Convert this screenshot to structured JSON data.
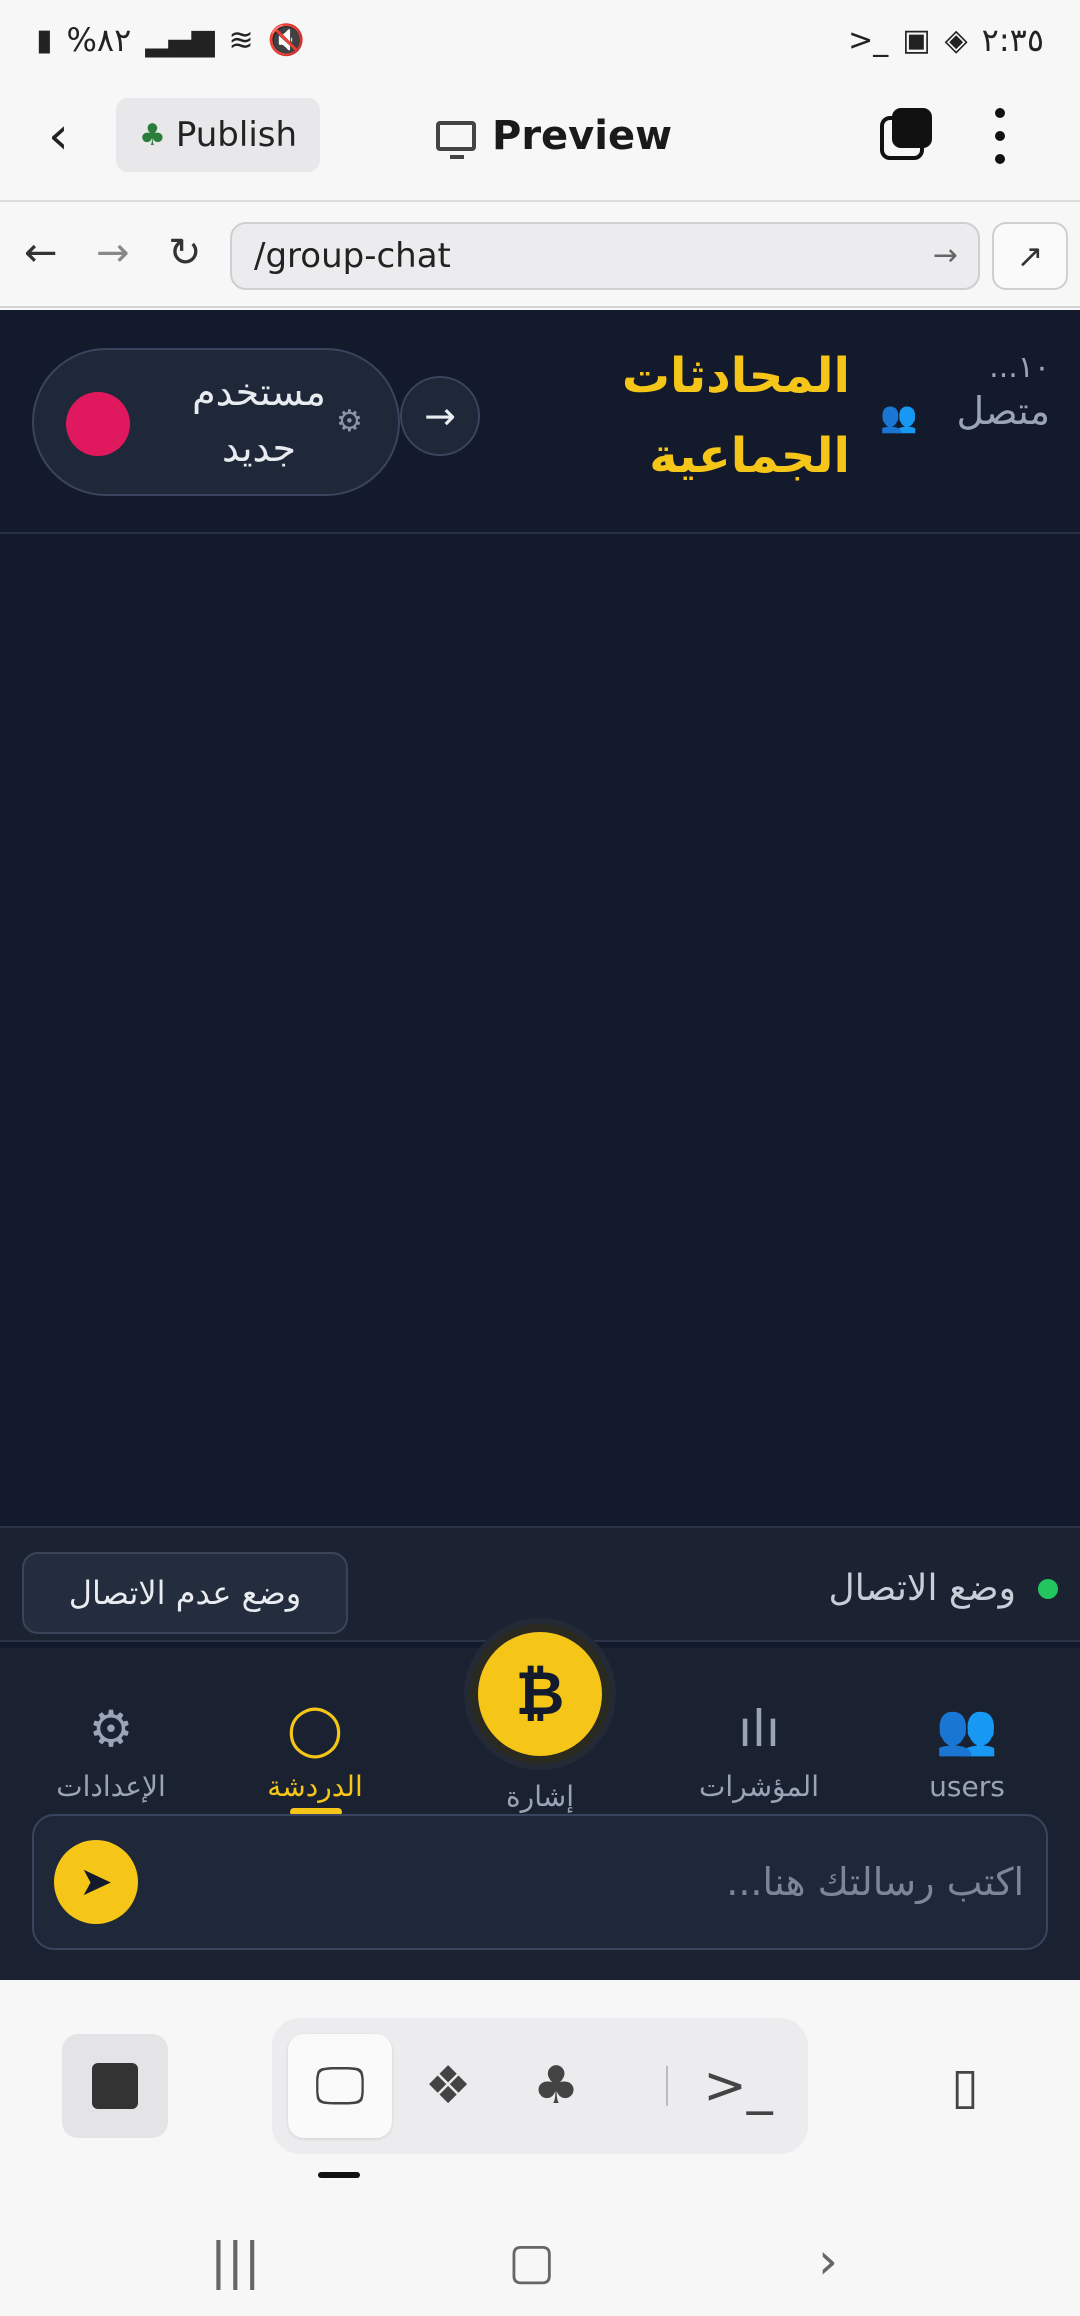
{
  "status_bar": {
    "time": "٢:٣٥",
    "battery": "%٨٢"
  },
  "app_toolbar": {
    "publish_label": "Publish",
    "preview_label": "Preview"
  },
  "browser": {
    "url": "/group-chat"
  },
  "chat_app": {
    "header": {
      "title": "المحادثات الجماعية",
      "online_count": "١٠...",
      "online_label": "متصل",
      "user_name": "مستخدم جديد",
      "user_color": "#e0195e"
    },
    "connection": {
      "status_label": "وضع الاتصال",
      "offline_button": "وضع عدم الاتصال"
    },
    "tabs": [
      {
        "label": "الإعدادات",
        "icon": "gear-icon"
      },
      {
        "label": "الدردشة",
        "icon": "chat-icon",
        "active": true
      },
      {
        "label": "إشارة",
        "icon": "signal-icon"
      },
      {
        "label": "المؤشرات",
        "icon": "bar-chart-icon"
      },
      {
        "label": "users",
        "icon": "users-icon"
      }
    ],
    "composer": {
      "placeholder": "اكتب رسالتك هنا..."
    }
  },
  "colors": {
    "app_bg": "#131a2b",
    "accent": "#f5c518",
    "online": "#22c55e"
  }
}
